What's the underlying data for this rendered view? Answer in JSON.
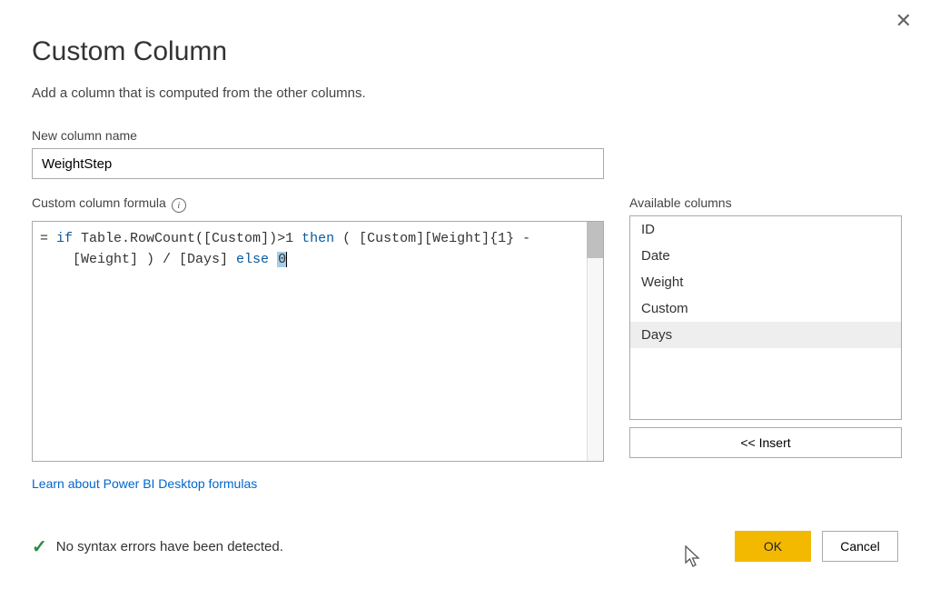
{
  "dialog": {
    "title": "Custom Column",
    "subtitle": "Add a column that is computed from the other columns.",
    "close_label": "✕"
  },
  "name_field": {
    "label": "New column name",
    "value": "WeightStep"
  },
  "formula": {
    "label": "Custom column formula",
    "eq": "=",
    "tokens": {
      "if": "if",
      "func": "Table.RowCount([Custom])>",
      "num1": "1",
      "then": "then",
      "part2": " ( [Custom][Weight]{",
      "num2": "1",
      "part3": "} -",
      "line2a": "[Weight] ) / [Days] ",
      "else": "else",
      "zero": "0"
    }
  },
  "available": {
    "label": "Available columns",
    "items": [
      "ID",
      "Date",
      "Weight",
      "Custom",
      "Days"
    ],
    "selected_index": 4,
    "insert_label": "<< Insert"
  },
  "link": {
    "learn": "Learn about Power BI Desktop formulas"
  },
  "status": {
    "text": "No syntax errors have been detected."
  },
  "buttons": {
    "ok": "OK",
    "cancel": "Cancel"
  }
}
